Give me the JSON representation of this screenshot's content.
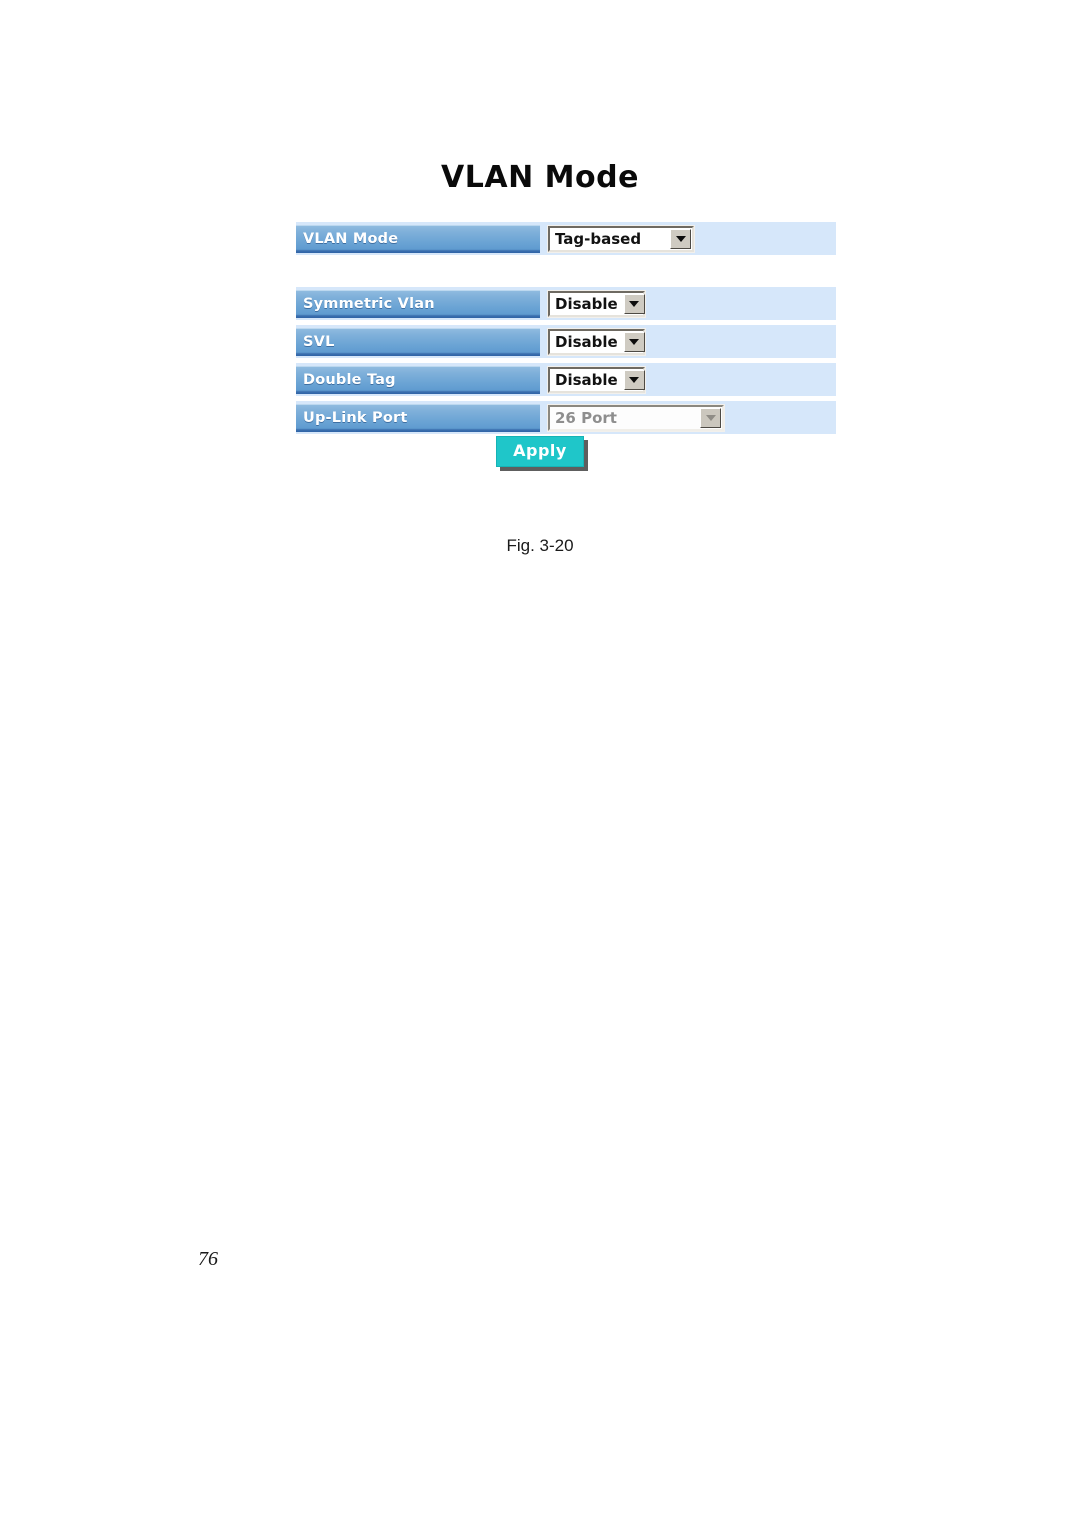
{
  "page": {
    "number": "76"
  },
  "figure": {
    "caption": "Fig. 3-20",
    "title": "VLAN Mode"
  },
  "panel": {
    "primary_group": [
      {
        "label": "VLAN Mode",
        "control": "dropdown",
        "value": "Tag-based",
        "disabled": false
      }
    ],
    "secondary_group": [
      {
        "label": "Symmetric Vlan",
        "control": "dropdown",
        "value": "Disable",
        "disabled": false
      },
      {
        "label": "SVL",
        "control": "dropdown",
        "value": "Disable",
        "disabled": false
      },
      {
        "label": "Double Tag",
        "control": "dropdown",
        "value": "Disable",
        "disabled": false
      },
      {
        "label": "Up-Link Port",
        "control": "dropdown",
        "value": "26 Port",
        "disabled": true
      }
    ],
    "apply_label": "Apply",
    "icons": {
      "dropdown_arrow": "chevron-down-icon"
    }
  },
  "colors": {
    "label_blue": "#6aa3d4",
    "label_blue_dark": "#2f64a6",
    "row_background": "#d6e7fa",
    "apply_teal": "#1fc6c9",
    "apply_shadow": "#5e5e5e",
    "page_background": "#ffffff",
    "disabled_text": "#8e8e8e"
  }
}
